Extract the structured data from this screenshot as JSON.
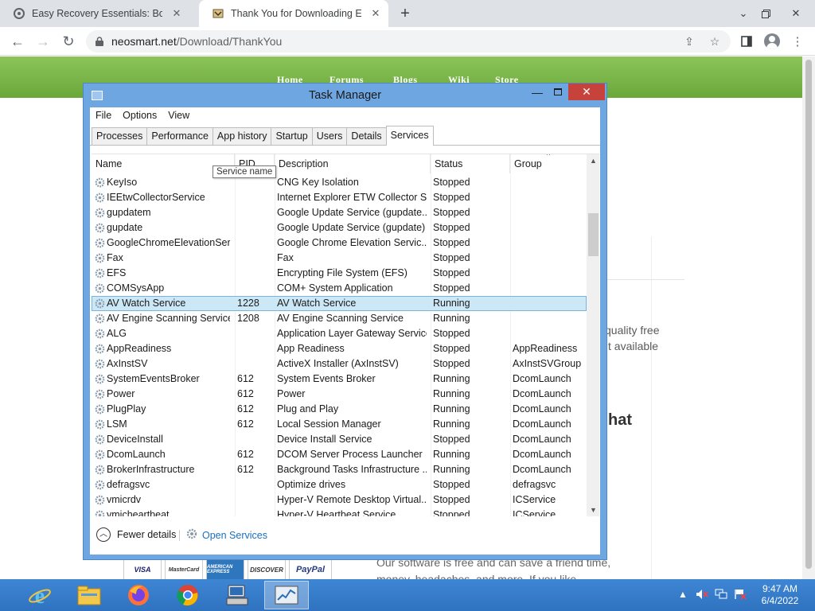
{
  "browser": {
    "tabs": [
      {
        "title": "Easy Recovery Essentials: Bootab",
        "active": false
      },
      {
        "title": "Thank You for Downloading Easy",
        "active": true
      }
    ],
    "url_host": "neosmart.net",
    "url_path": "/Download/ThankYou"
  },
  "website": {
    "nav": [
      "Home",
      "Forums",
      "Blogs",
      "Wiki",
      "Store"
    ],
    "side_text_1": "quality free",
    "side_text_2": "t available",
    "heading_fragment": "hat",
    "paragraph": "Our software is free and can save a friend time, money, headaches, and more. If you like",
    "cards": [
      "VISA",
      "MasterCard",
      "AMERICAN EXPRESS",
      "DISCOVER",
      "PayPal"
    ]
  },
  "task_manager": {
    "title": "Task Manager",
    "menu": [
      "File",
      "Options",
      "View"
    ],
    "tabs": [
      "Processes",
      "Performance",
      "App history",
      "Startup",
      "Users",
      "Details",
      "Services"
    ],
    "active_tab": "Services",
    "columns": {
      "name": "Name",
      "pid": "PID",
      "description": "Description",
      "status": "Status",
      "group": "Group"
    },
    "tooltip": "Service name",
    "services": [
      {
        "name": "KeyIso",
        "pid": "",
        "description": "CNG Key Isolation",
        "status": "Stopped",
        "group": ""
      },
      {
        "name": "IEEtwCollectorService",
        "pid": "",
        "description": "Internet Explorer ETW Collector S...",
        "status": "Stopped",
        "group": ""
      },
      {
        "name": "gupdatem",
        "pid": "",
        "description": "Google Update Service (gupdate...",
        "status": "Stopped",
        "group": ""
      },
      {
        "name": "gupdate",
        "pid": "",
        "description": "Google Update Service (gupdate)",
        "status": "Stopped",
        "group": ""
      },
      {
        "name": "GoogleChromeElevationSer...",
        "pid": "",
        "description": "Google Chrome Elevation Servic...",
        "status": "Stopped",
        "group": ""
      },
      {
        "name": "Fax",
        "pid": "",
        "description": "Fax",
        "status": "Stopped",
        "group": ""
      },
      {
        "name": "EFS",
        "pid": "",
        "description": "Encrypting File System (EFS)",
        "status": "Stopped",
        "group": ""
      },
      {
        "name": "COMSysApp",
        "pid": "",
        "description": "COM+ System Application",
        "status": "Stopped",
        "group": ""
      },
      {
        "name": "AV Watch Service",
        "pid": "1228",
        "description": "AV Watch Service",
        "status": "Running",
        "group": "",
        "selected": true
      },
      {
        "name": "AV Engine Scanning Service",
        "pid": "1208",
        "description": "AV Engine Scanning Service",
        "status": "Running",
        "group": ""
      },
      {
        "name": "ALG",
        "pid": "",
        "description": "Application Layer Gateway Service",
        "status": "Stopped",
        "group": ""
      },
      {
        "name": "AppReadiness",
        "pid": "",
        "description": "App Readiness",
        "status": "Stopped",
        "group": "AppReadiness"
      },
      {
        "name": "AxInstSV",
        "pid": "",
        "description": "ActiveX Installer (AxInstSV)",
        "status": "Stopped",
        "group": "AxInstSVGroup"
      },
      {
        "name": "SystemEventsBroker",
        "pid": "612",
        "description": "System Events Broker",
        "status": "Running",
        "group": "DcomLaunch"
      },
      {
        "name": "Power",
        "pid": "612",
        "description": "Power",
        "status": "Running",
        "group": "DcomLaunch"
      },
      {
        "name": "PlugPlay",
        "pid": "612",
        "description": "Plug and Play",
        "status": "Running",
        "group": "DcomLaunch"
      },
      {
        "name": "LSM",
        "pid": "612",
        "description": "Local Session Manager",
        "status": "Running",
        "group": "DcomLaunch"
      },
      {
        "name": "DeviceInstall",
        "pid": "",
        "description": "Device Install Service",
        "status": "Stopped",
        "group": "DcomLaunch"
      },
      {
        "name": "DcomLaunch",
        "pid": "612",
        "description": "DCOM Server Process Launcher",
        "status": "Running",
        "group": "DcomLaunch"
      },
      {
        "name": "BrokerInfrastructure",
        "pid": "612",
        "description": "Background Tasks Infrastructure ...",
        "status": "Running",
        "group": "DcomLaunch"
      },
      {
        "name": "defragsvc",
        "pid": "",
        "description": "Optimize drives",
        "status": "Stopped",
        "group": "defragsvc"
      },
      {
        "name": "vmicrdv",
        "pid": "",
        "description": "Hyper-V Remote Desktop Virtual...",
        "status": "Stopped",
        "group": "ICService"
      },
      {
        "name": "vmicheartbeat",
        "pid": "",
        "description": "Hyper-V Heartbeat Service",
        "status": "Stopped",
        "group": "ICService"
      }
    ],
    "fewer_details": "Fewer details",
    "open_services": "Open Services"
  },
  "taskbar": {
    "apps": [
      "internet-explorer-icon",
      "file-explorer-icon",
      "firefox-icon",
      "chrome-icon",
      "control-panel-icon",
      "task-manager-icon"
    ],
    "active_app": "task-manager-icon",
    "time": "9:47 AM",
    "date": "6/4/2022"
  },
  "colors": {
    "task_manager_frame": "#6ea6e2",
    "selected_row": "#cce8f7",
    "taskbar": "#2f73c0",
    "site_nav": "#7ab84a",
    "close_button": "#c7423a"
  }
}
